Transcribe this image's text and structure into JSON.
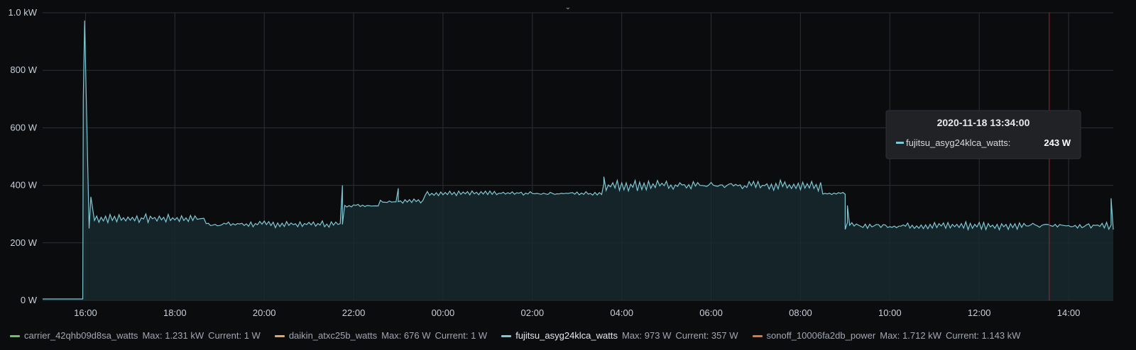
{
  "colors": {
    "series_line": "#7fc8d4",
    "series_fill": "#17292d",
    "grid": "#2c3036",
    "cursor": "#c4162a",
    "carrier": "#73bf69",
    "daikin": "#e0a860",
    "fujitsu": "#7fc8d4",
    "sonoff": "#e0753e"
  },
  "icons": {
    "collapse": "chevron-down-icon"
  },
  "chart_data": {
    "type": "area",
    "ylim": [
      0,
      1000
    ],
    "y_ticks": [
      {
        "value": 0,
        "label": "0 W"
      },
      {
        "value": 200,
        "label": "200 W"
      },
      {
        "value": 400,
        "label": "400 W"
      },
      {
        "value": 600,
        "label": "600 W"
      },
      {
        "value": 800,
        "label": "800 W"
      },
      {
        "value": 1000,
        "label": "1.0 kW"
      }
    ],
    "x_unit": "hours since 2020-11-17 00:00",
    "xlim": [
      36.0,
      39.0
    ],
    "x_ticks": [
      {
        "value": 16,
        "label": "16:00"
      },
      {
        "value": 18,
        "label": "18:00"
      },
      {
        "value": 20,
        "label": "20:00"
      },
      {
        "value": 22,
        "label": "22:00"
      },
      {
        "value": 24,
        "label": "00:00"
      },
      {
        "value": 26,
        "label": "02:00"
      },
      {
        "value": 28,
        "label": "04:00"
      },
      {
        "value": 30,
        "label": "06:00"
      },
      {
        "value": 32,
        "label": "08:00"
      },
      {
        "value": 34,
        "label": "10:00"
      },
      {
        "value": 36,
        "label": "12:00"
      },
      {
        "value": 38,
        "label": "14:00"
      }
    ],
    "x_range": [
      15.04,
      39.0
    ],
    "grid": true,
    "series": [
      {
        "name": "fujitsu_asyg24klca_watts",
        "segments": [
          {
            "from": 15.04,
            "to": 15.95,
            "base": 5,
            "amp": 0
          },
          {
            "from": 16.2,
            "to": 18.7,
            "base": 285,
            "amp": 15
          },
          {
            "from": 18.7,
            "to": 21.8,
            "base": 265,
            "amp": 12
          },
          {
            "from": 21.8,
            "to": 22.6,
            "base": 330,
            "amp": 6
          },
          {
            "from": 22.6,
            "to": 23.6,
            "base": 345,
            "amp": 10
          },
          {
            "from": 23.6,
            "to": 27.6,
            "base": 372,
            "amp": 8
          },
          {
            "from": 27.6,
            "to": 32.5,
            "base": 400,
            "amp": 18
          },
          {
            "from": 32.5,
            "to": 33.0,
            "base": 372,
            "amp": 4
          },
          {
            "from": 33.0,
            "to": 39.0,
            "base": 260,
            "amp": 14
          }
        ],
        "spikes": [
          {
            "x": 15.95,
            "y": 700
          },
          {
            "x": 15.98,
            "y": 973
          },
          {
            "x": 16.02,
            "y": 680
          },
          {
            "x": 16.08,
            "y": 250
          },
          {
            "x": 16.12,
            "y": 360
          },
          {
            "x": 21.75,
            "y": 400
          },
          {
            "x": 23.0,
            "y": 390
          },
          {
            "x": 27.6,
            "y": 430
          },
          {
            "x": 33.05,
            "y": 330
          },
          {
            "x": 38.95,
            "y": 355
          }
        ]
      }
    ],
    "cursor_x": 37.567
  },
  "tooltip": {
    "title": "2020-11-18 13:34:00",
    "series": "fujitsu_asyg24klca_watts:",
    "value": "243 W"
  },
  "legend": [
    {
      "key": "carrier",
      "name": "carrier_42qhb09d8sa_watts",
      "max": "Max: 1.231 kW",
      "current": "Current: 1 W"
    },
    {
      "key": "daikin",
      "name": "daikin_atxc25b_watts",
      "max": "Max: 676 W",
      "current": "Current: 1 W"
    },
    {
      "key": "fujitsu",
      "name": "fujitsu_asyg24klca_watts",
      "max": "Max: 973 W",
      "current": "Current: 357 W",
      "highlighted": true
    },
    {
      "key": "sonoff",
      "name": "sonoff_10006fa2db_power",
      "max": "Max: 1.712 kW",
      "current": "Current: 1.143 kW"
    }
  ]
}
